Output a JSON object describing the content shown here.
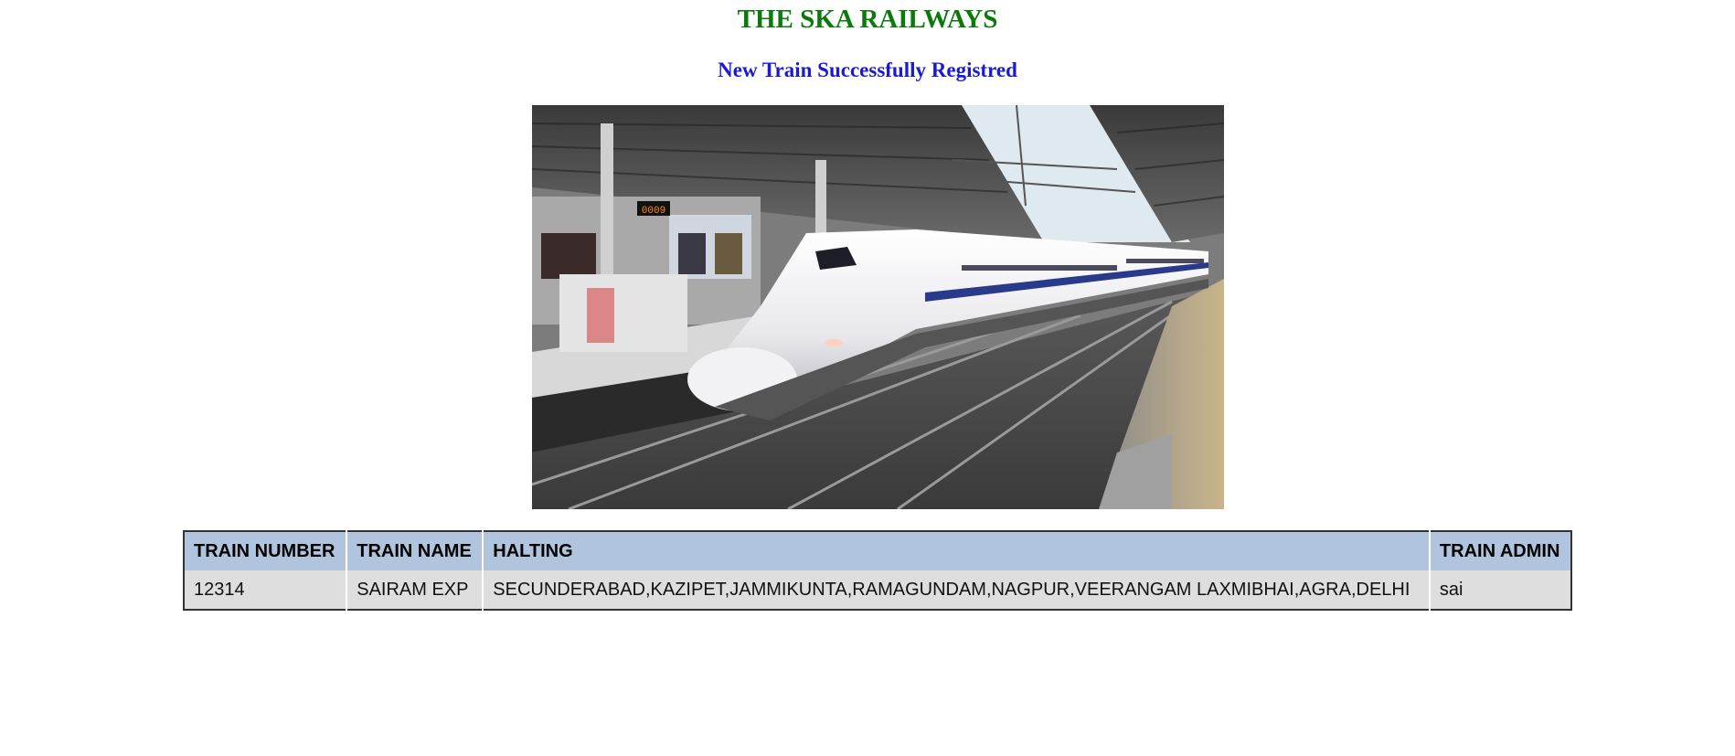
{
  "header": {
    "title": "THE SKA RAILWAYS",
    "title_color": "#0a7a0a",
    "message": "New Train Successfully Registred",
    "message_color": "#1a1ad6"
  },
  "photo": {
    "subject": "bullet train at station platform",
    "platform_display": "0009"
  },
  "table": {
    "header_color": "#b0c4de",
    "row_color": "#dedede",
    "columns": [
      "TRAIN NUMBER",
      "TRAIN NAME",
      "HALTING",
      "TRAIN ADMIN"
    ],
    "rows": [
      {
        "train_number": "12314",
        "train_name": "SAIRAM EXP",
        "halting": "SECUNDERABAD,KAZIPET,JAMMIKUNTA,RAMAGUNDAM,NAGPUR,VEERANGAM LAXMIBHAI,AGRA,DELHI",
        "train_admin": "sai"
      }
    ]
  }
}
